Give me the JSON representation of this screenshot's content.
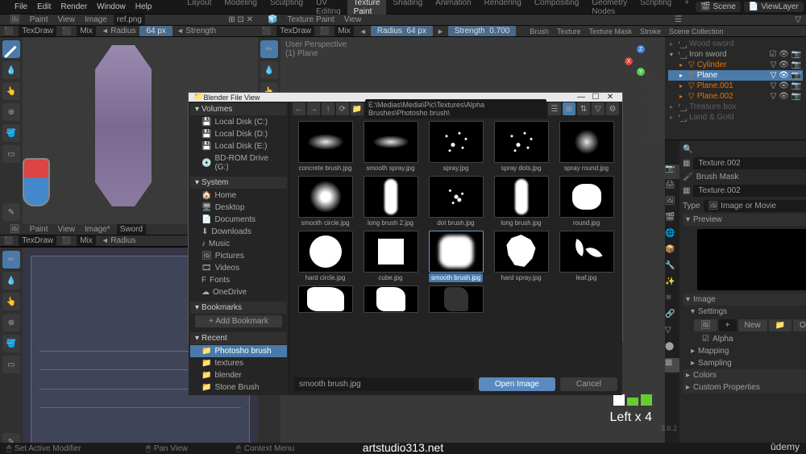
{
  "menu": {
    "items": [
      "File",
      "Edit",
      "Render",
      "Window",
      "Help"
    ]
  },
  "workspace_tabs": [
    "Layout",
    "Modeling",
    "Sculpting",
    "UV Editing",
    "Texture Paint",
    "Shading",
    "Animation",
    "Rendering",
    "Compositing",
    "Geometry Nodes",
    "Scripting"
  ],
  "workspace_active": "Texture Paint",
  "scene_field": "Scene",
  "viewlayer_field": "ViewLayer",
  "header1": {
    "mode": "Paint",
    "view": "View",
    "image": "Image",
    "file": "ref.png"
  },
  "tool_header": {
    "brush": "TexDraw",
    "blend": "Mix",
    "radius_label": "Radius",
    "radius_val": "64 px",
    "strength_label": "Strength",
    "strength_val": "0.700",
    "brush_group": "Brush",
    "texture_group": "Texture",
    "texture_mask_group": "Texture Mask",
    "stroke_group": "Stroke"
  },
  "mid_header": {
    "mode": "Texture Paint",
    "view": "View"
  },
  "mid_overlay": {
    "line1": "User Perspective",
    "line2": "(1) Plane"
  },
  "bottom_label": "Left x 4",
  "vp2_header": {
    "mode": "Paint",
    "view": "View",
    "image": "Image*",
    "file": "Sword"
  },
  "vp2_tool": {
    "brush": "TexDraw",
    "blend": "Mix",
    "radius_label": "Radius"
  },
  "outliner": {
    "root": "Scene Collection",
    "items": [
      {
        "label": "Wood sword",
        "grey": true
      },
      {
        "label": "Iron sword",
        "children": [
          {
            "label": "Cylinder",
            "color": "orange"
          },
          {
            "label": "Plane",
            "color": "orange",
            "active": true
          },
          {
            "label": "Plane.001",
            "color": "orange"
          },
          {
            "label": "Plane.002",
            "color": "orange"
          }
        ]
      },
      {
        "label": "Treasure box",
        "grey": true
      },
      {
        "label": "Land & Gold",
        "grey": true
      }
    ]
  },
  "props": {
    "tex_name": "Texture.002",
    "brush_mask": "Brush Mask",
    "tex_name2": "Texture.002",
    "type_label": "Type",
    "type_value": "Image or Movie",
    "preview": "Preview",
    "image": "Image",
    "settings": "Settings",
    "new": "New",
    "open": "Open",
    "alpha": "Alpha",
    "mapping": "Mapping",
    "sampling": "Sampling",
    "colors": "Colors",
    "custom": "Custom Properties"
  },
  "dialog": {
    "title": "Blender File View",
    "path": "E:\\Medias\\Media\\Pic\\Textures\\Alpha Brushes\\Photosho brush\\",
    "volumes_hdr": "Volumes",
    "volumes": [
      "Local Disk (C:)",
      "Local Disk (D:)",
      "Local Disk (E:)",
      "BD-ROM Drive (G:)"
    ],
    "system_hdr": "System",
    "system": [
      "Home",
      "Desktop",
      "Documents",
      "Downloads",
      "Music",
      "Pictures",
      "Videos",
      "Fonts",
      "OneDrive"
    ],
    "bookmarks_hdr": "Bookmarks",
    "add_bookmark": "Add Bookmark",
    "recent_hdr": "Recent",
    "recent": [
      "Photosho brush",
      "textures",
      "blender",
      "Stone Brush"
    ],
    "thumbs": [
      "concrete brush.jpg",
      "smooth spray.jpg",
      "spray.jpg",
      "spray dots.jpg",
      "spray round.jpg",
      "smooth circle.jpg",
      "long brush 2.jpg",
      "dot brush.jpg",
      "long brush.jpg",
      "round.jpg",
      "hard circle.jpg",
      "cube.jpg",
      "smooth brush.jpg",
      "hard spray.jpg",
      "leaf.jpg",
      "",
      "",
      ""
    ],
    "selected": "smooth brush.jpg",
    "filename": "smooth brush.jpg",
    "open": "Open Image",
    "cancel": "Cancel"
  },
  "footer": {
    "modifier": "Set Active Modifier",
    "pan": "Pan View",
    "context": "Context Menu"
  },
  "version": "3.6.2",
  "watermark": "artstudio313.net",
  "udemy": "ûdemy"
}
